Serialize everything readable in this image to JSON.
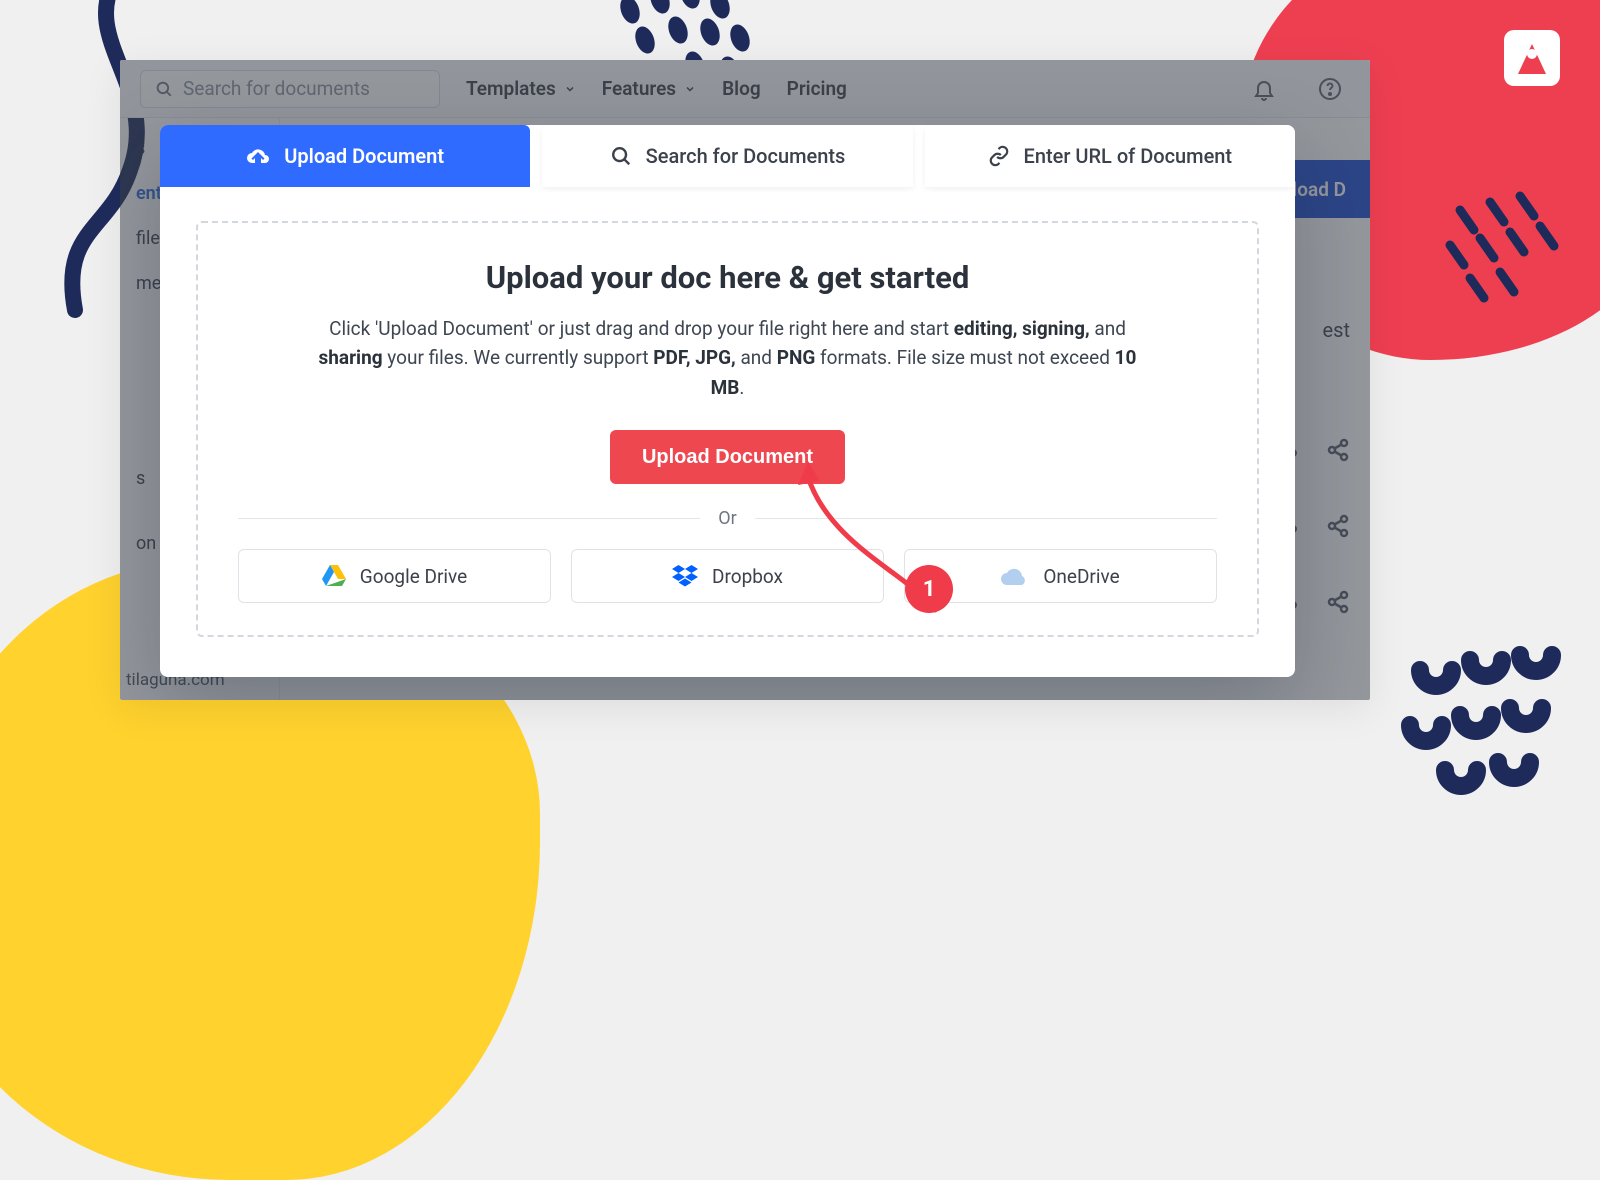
{
  "topbar": {
    "search_placeholder": "Search for documents",
    "nav": {
      "templates": "Templates",
      "features": "Features",
      "blog": "Blog",
      "pricing": "Pricing"
    }
  },
  "sidebar": {
    "items": [
      "s",
      "ents",
      "files",
      "me",
      "s",
      "on &"
    ],
    "footer": "tilaguna.com"
  },
  "main": {
    "upload_button_partial": "pload D",
    "filter_by_partial": "est"
  },
  "modal": {
    "tabs": {
      "upload": "Upload Document",
      "search": "Search for Documents",
      "url": "Enter URL of Document"
    },
    "heading": "Upload your doc here & get started",
    "description_parts": {
      "pre": "Click 'Upload Document' or just drag and drop your file right here and start ",
      "bold1": "editing, signing,",
      "mid1": " and ",
      "bold2": "sharing",
      "mid2": " your files. We currently support ",
      "bold3": "PDF, JPG,",
      "mid3": " and ",
      "bold4": "PNG",
      "mid4": " formats. File size must not exceed ",
      "bold5": "10 MB",
      "post": "."
    },
    "upload_button": "Upload Document",
    "or_label": "Or",
    "providers": {
      "gdrive": "Google Drive",
      "dropbox": "Dropbox",
      "onedrive": "OneDrive"
    }
  },
  "annotation": {
    "step": "1"
  }
}
